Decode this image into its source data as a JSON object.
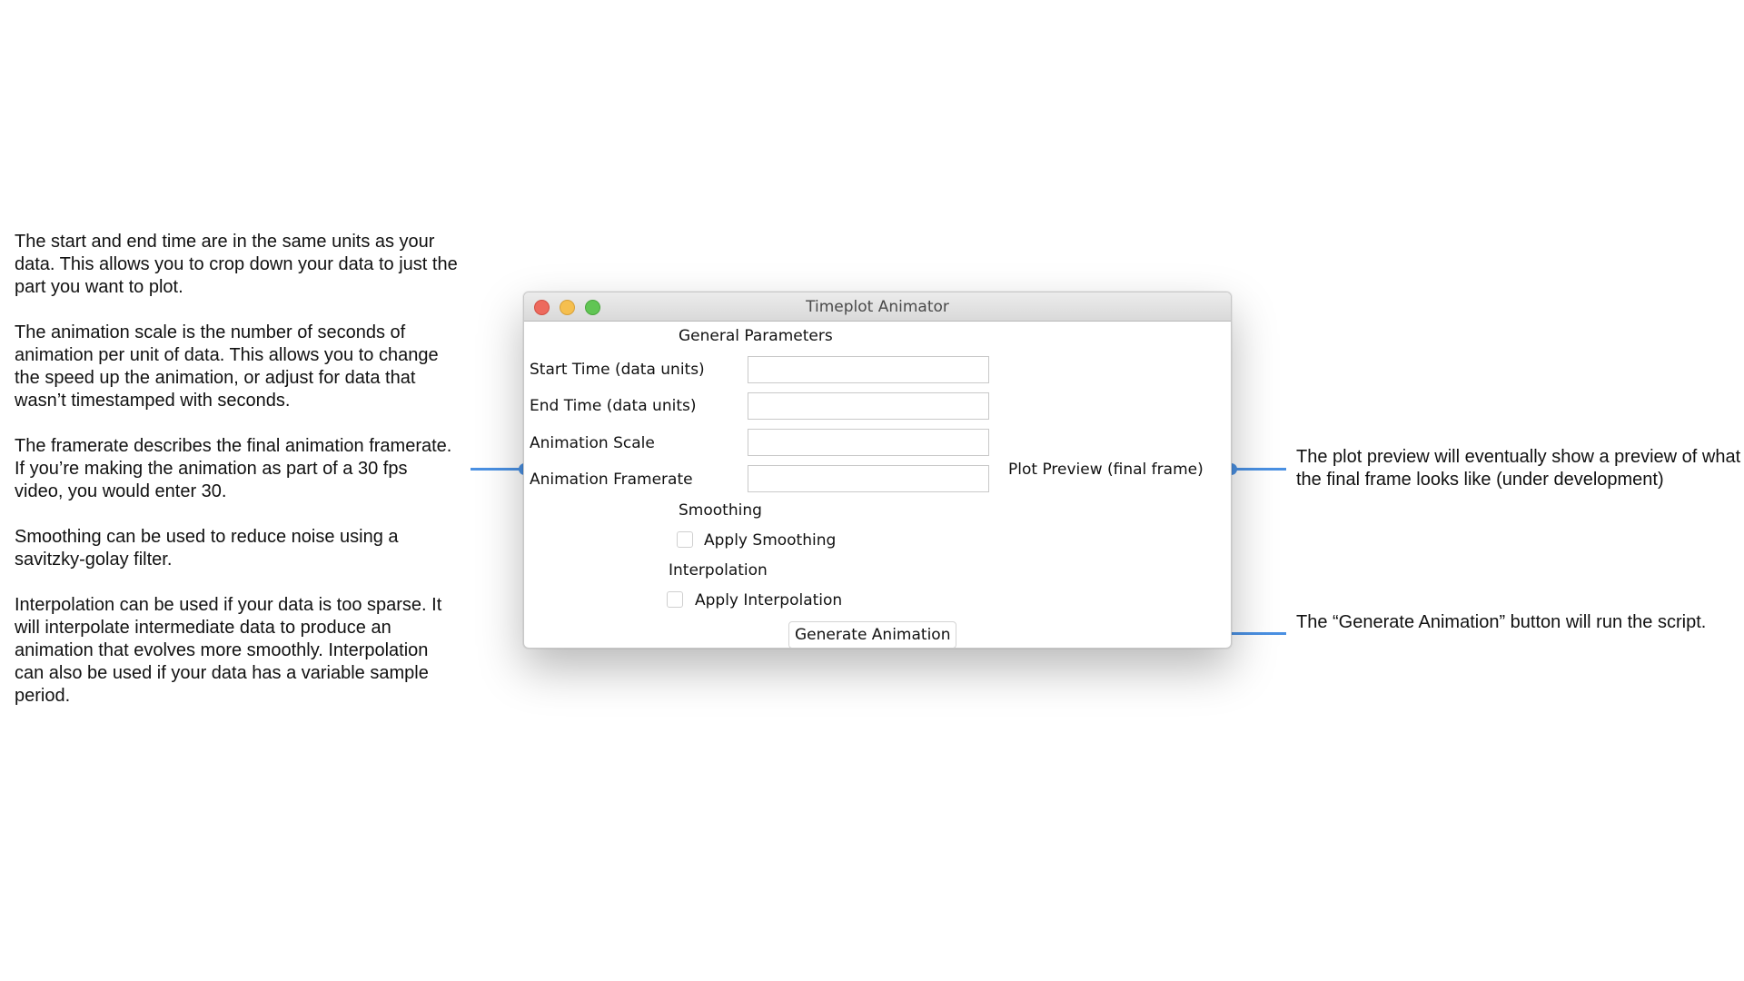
{
  "window": {
    "title": "Timeplot Animator"
  },
  "form": {
    "section_general": "General Parameters",
    "start_time_label": "Start Time (data units)",
    "start_time_value": "",
    "end_time_label": "End Time (data units)",
    "end_time_value": "",
    "animation_scale_label": "Animation Scale",
    "animation_scale_value": "",
    "animation_framerate_label": "Animation Framerate",
    "animation_framerate_value": "",
    "plot_preview_label": "Plot Preview (final frame)",
    "section_smoothing": "Smoothing",
    "apply_smoothing_label": "Apply Smoothing",
    "apply_smoothing_checked": false,
    "section_interpolation": "Interpolation",
    "apply_interpolation_label": "Apply Interpolation",
    "apply_interpolation_checked": false,
    "generate_button_label": "Generate Animation"
  },
  "annotations": {
    "left": [
      "The start and end time are in the same units as your data. This allows you to crop down your data to just the part you want to plot.",
      "The animation scale is the number of seconds of animation per unit of data. This allows you to change the speed up the animation, or adjust for data that wasn’t timestamped with seconds.",
      "The framerate describes the final animation framerate. If you’re making the animation as part of a 30 fps video, you would enter 30.",
      "Smoothing can be used to reduce noise using a savitzky-golay filter.",
      "Interpolation can be used if your data is too sparse. It will interpolate intermediate data to produce an animation that evolves more smoothly. Interpolation can also be used if your data has a variable sample period."
    ],
    "preview": "The plot preview will eventually show a preview of what the final frame looks like (under development)",
    "generate": "The “Generate Animation” button will run the script."
  },
  "colors": {
    "callout": "#4a90e2",
    "close_button": "#ed6a5e",
    "minimize_button": "#f5bf4f",
    "maximize_button": "#61c554"
  }
}
